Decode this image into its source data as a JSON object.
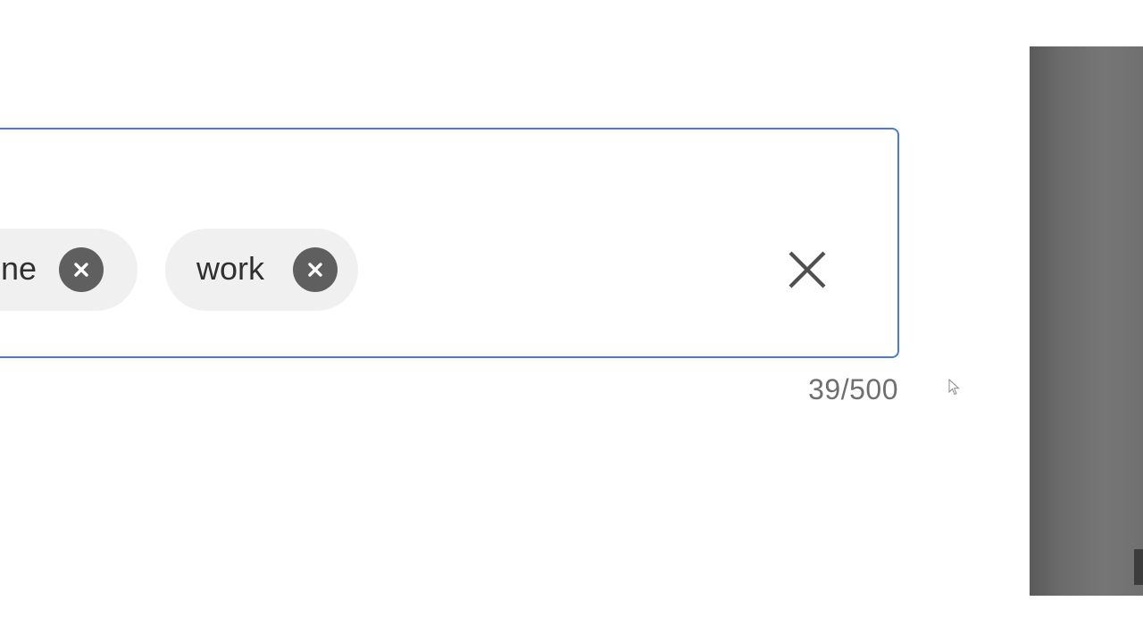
{
  "tag_input": {
    "chips": [
      {
        "label": "online",
        "remove_icon": "close-circle-icon"
      },
      {
        "label": "work",
        "remove_icon": "close-circle-icon"
      }
    ],
    "clear_icon": "close-icon",
    "char_counter": "39/500"
  },
  "colors": {
    "focus_border": "#4a7bd0",
    "chip_background": "#f0f0f0",
    "chip_remove_background": "#5f5f5f",
    "counter_text": "#6f6f6f",
    "side_panel": "#6b6b6b"
  }
}
